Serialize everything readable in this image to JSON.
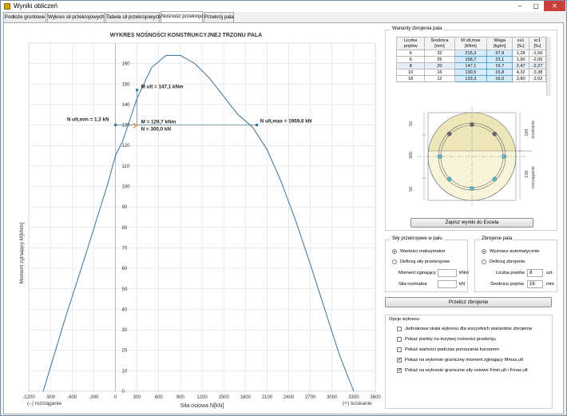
{
  "window": {
    "title": "Wyniki obliczeń",
    "min": "–",
    "max": "▢",
    "close": "✕"
  },
  "tabs": [
    "Podłoże gruntowe",
    "Wykres sił przekrojowych",
    "Tabela sił przekrojowych",
    "Nośność przekroju",
    "Przekrój pala"
  ],
  "active_tab": 3,
  "chart_data": {
    "type": "line",
    "title": "WYKRES NOŚNOŚCI KONSTRUKCYJNEJ TRZONU PALA",
    "xlabel": "Siła osiowa N[kN]",
    "ylabel": "Moment zginający M[kNm]",
    "x_ticks": [
      "-1200",
      "-900",
      "-600",
      "-300",
      "0",
      "300",
      "600",
      "900",
      "1200",
      "1500",
      "1800",
      "2100",
      "2400",
      "2700",
      "3000",
      "3300",
      "3600"
    ],
    "y_ticks": [
      "0",
      "10",
      "20",
      "30",
      "40",
      "50",
      "60",
      "70",
      "80",
      "90",
      "100",
      "110",
      "120",
      "130",
      "140",
      "150",
      "160"
    ],
    "xlim": [
      -1200,
      3600
    ],
    "ylim": [
      0,
      170
    ],
    "grid": true,
    "series": [
      {
        "x": [
          -1000,
          -700,
          -400,
          -100,
          0,
          100,
          300,
          500,
          700,
          900,
          1100,
          1300,
          1500,
          1700,
          1900,
          2100,
          2300,
          2500,
          2700,
          2900,
          3100,
          3300
        ],
        "y": [
          0,
          35,
          68,
          102,
          115,
          122,
          143,
          158,
          164,
          164,
          160,
          153,
          144,
          135,
          129,
          118,
          102,
          83,
          62,
          40,
          18,
          0
        ]
      }
    ],
    "markers": [
      {
        "x": 1.3,
        "y": 130,
        "label": "N ult,min = 1,3 kN"
      },
      {
        "x": 300,
        "y": 147.1,
        "label": "M ult = 147,1 kNm"
      },
      {
        "x": 1959.6,
        "y": 130,
        "label": "N ult,max = 1959,6 kN"
      }
    ],
    "load_point": {
      "x": 300,
      "y": 129.7,
      "label_m": "M = 129,7 kNm",
      "label_n": "N = 300,0 kN"
    },
    "x_note_left": "(–) rozciąganie",
    "x_note_right": "(+) ściskanie"
  },
  "variants": {
    "title": "Warianty zbrojenia pala",
    "headers": [
      "Liczba prętów",
      "Średnica [mm]",
      "M ult,max [kNm]",
      "Waga [kg/m]",
      "εs1 [‰]",
      "εc1 [‰]"
    ],
    "rows": [
      [
        "6",
        "32",
        "215,3",
        "37,9",
        "1,28",
        "-1,56"
      ],
      [
        "6",
        "25",
        "158,7",
        "23,1",
        "1,90",
        "-2,05"
      ],
      [
        "8",
        "20",
        "147,1",
        "19,7",
        "2,47",
        "-2,27"
      ],
      [
        "10",
        "16",
        "130,5",
        "15,8",
        "4,32",
        "-3,38"
      ],
      [
        "18",
        "12",
        "133,3",
        "16,0",
        "3,80",
        "-3,02"
      ]
    ],
    "selected_row": 2
  },
  "section": {
    "dim_top": "50",
    "dim_mid": "300",
    "dim_bot": "50",
    "dim_right_top": "164",
    "dim_right_bot": "236",
    "label_compression": "ściskanie",
    "label_tension": "rozciąganie"
  },
  "excel_button": "Zapisz wyniki do Excela",
  "forces": {
    "title": "Siły przekrojowe w palu",
    "opt_max": "Wartości maksymalne",
    "opt_define": "Definiuj siły przekrojowe",
    "moment_label": "Moment zginający",
    "moment_unit": "kNm",
    "normal_label": "Siła normalna",
    "normal_unit": "kN"
  },
  "reinf": {
    "title": "Zbrojenie pala",
    "opt_auto": "Wyznacz automatycznie",
    "opt_define": "Definiuj zbrojenie",
    "bars_label": "Liczba prętów",
    "bars_value": "8",
    "bars_unit": "szt.",
    "diam_label": "Średnica prętów",
    "diam_value": "16",
    "diam_unit": "mm"
  },
  "recalc_button": "Przelicz zbrojenie",
  "options": {
    "title": "Opcje wykresu",
    "items": [
      {
        "label": "Jednakowa skala wykresu dla wszystkich wariantów zbrojenia",
        "checked": false
      },
      {
        "label": "Pokaż punkty na krzywej nośności przekroju",
        "checked": false
      },
      {
        "label": "Pokaż wartości podczas poruszania kursorem",
        "checked": false
      },
      {
        "label": "Pokaż na wykresie graniczny moment zginający Mmax,ult",
        "checked": true
      },
      {
        "label": "Pokaż na wykresie graniczne siły osiowe Fmin,ult i Fmax,ult",
        "checked": true
      }
    ]
  }
}
